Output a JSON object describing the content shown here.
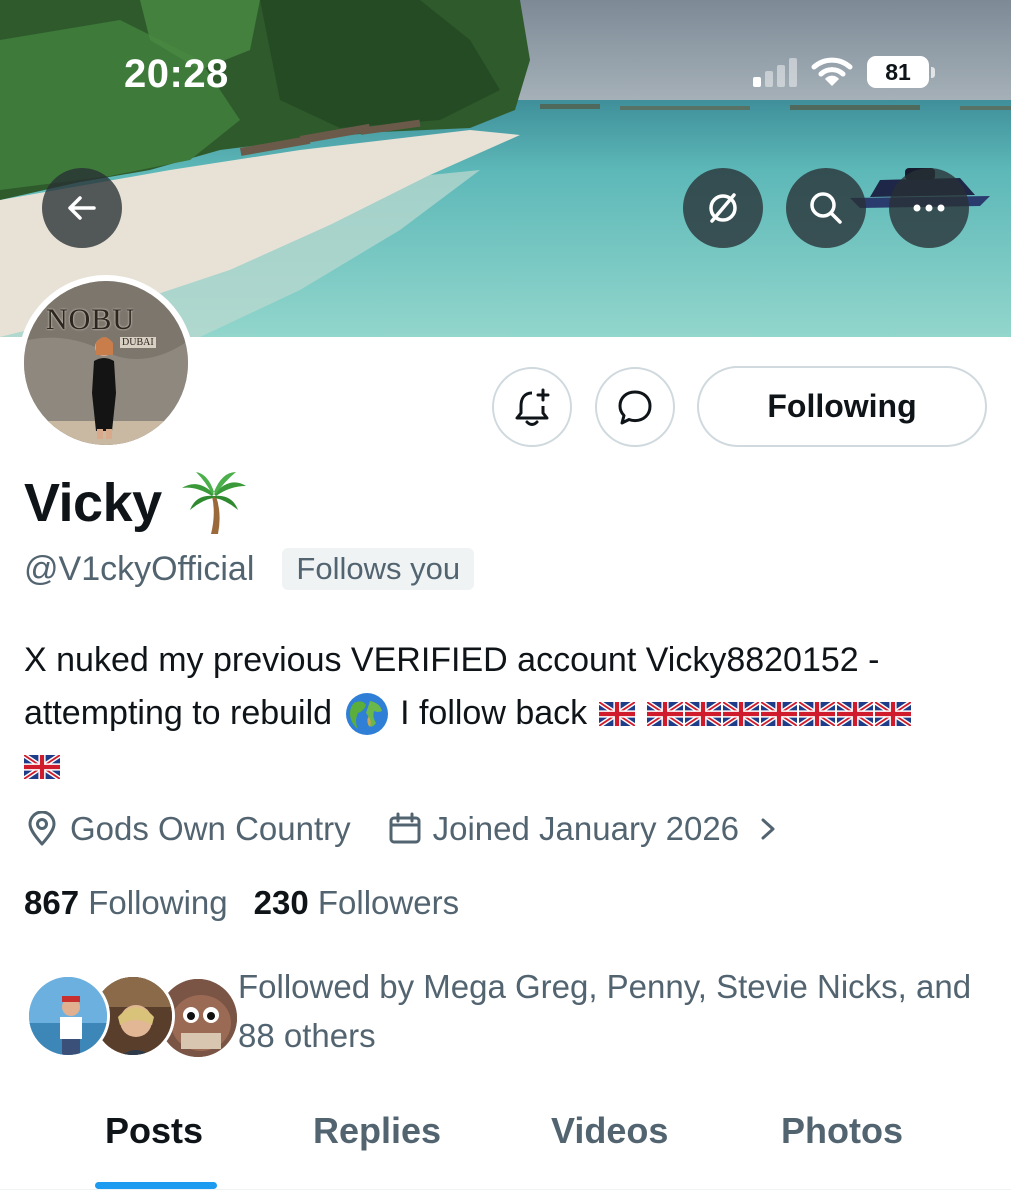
{
  "status_bar": {
    "time": "20:28",
    "battery": "81",
    "signal_bars_active": 1,
    "signal_bars_total": 4,
    "wifi": "wifi-icon"
  },
  "banner": {
    "back_icon": "arrow-left-icon",
    "grok_icon": "slash-circle-icon",
    "search_icon": "search-icon",
    "more_icon": "more-icon"
  },
  "profile": {
    "avatar_sign_text": "NOBU",
    "avatar_sign_subtext": "DUBAI",
    "display_name": "Vicky",
    "name_emoji": "palm-tree",
    "handle": "@V1ckyOfficial",
    "follows_you": "Follows you",
    "bio_line1": "X nuked my previous VERIFIED account Vicky8820152 -",
    "bio_line2": "attempting to rebuild",
    "bio_line2b": "I follow back",
    "bio_flag_count": 9,
    "location": "Gods Own Country",
    "joined": "Joined January 2026",
    "following_count": "867",
    "following_label": "Following",
    "followers_count": "230",
    "followers_label": "Followers",
    "followed_by": "Followed by Mega Greg, Penny, Stevie Nicks, and 88 others"
  },
  "actions": {
    "notify_icon": "bell-plus-icon",
    "message_icon": "message-bubble-icon",
    "following_label": "Following"
  },
  "tabs": [
    {
      "label": "Posts",
      "active": true
    },
    {
      "label": "Replies",
      "active": false
    },
    {
      "label": "Videos",
      "active": false
    },
    {
      "label": "Photos",
      "active": false
    }
  ],
  "colors": {
    "accent": "#1d9bf0",
    "text_primary": "#0f1419",
    "text_secondary": "#536471",
    "border": "#cfd9de"
  }
}
